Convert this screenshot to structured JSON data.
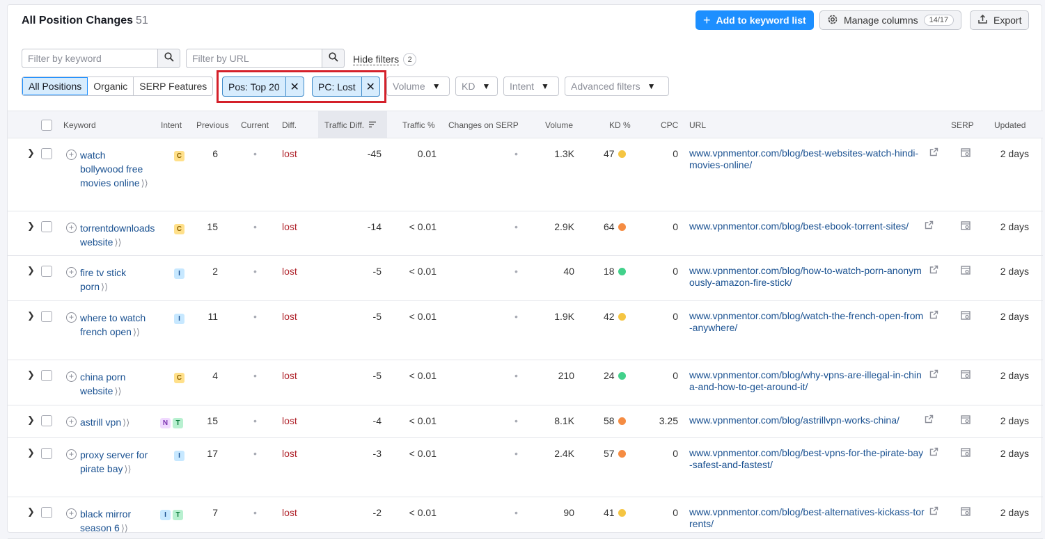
{
  "header": {
    "title": "All Position Changes",
    "count": "51",
    "add_button": "Add to keyword list",
    "manage_columns": "Manage columns",
    "columns_badge": "14/17",
    "export": "Export"
  },
  "filters": {
    "keyword_placeholder": "Filter by keyword",
    "url_placeholder": "Filter by URL",
    "hide_filters": "Hide filters",
    "hide_filters_count": "2",
    "segments": [
      "All Positions",
      "Organic",
      "SERP Features"
    ],
    "chip_pos": "Pos: Top 20",
    "chip_pc": "PC: Lost",
    "volume": "Volume",
    "kd": "KD",
    "intent": "Intent",
    "advanced": "Advanced filters"
  },
  "columns": {
    "keyword": "Keyword",
    "intent": "Intent",
    "previous": "Previous",
    "current": "Current",
    "diff": "Diff.",
    "traffic_diff": "Traffic Diff.",
    "traffic_pct": "Traffic %",
    "changes_serp": "Changes on SERP",
    "volume": "Volume",
    "kd": "KD %",
    "cpc": "CPC",
    "url": "URL",
    "serp": "SERP",
    "updated": "Updated"
  },
  "colors": {
    "kd_yellow": "#f5c542",
    "kd_orange": "#f58c42",
    "kd_green": "#42d18b"
  },
  "rows": [
    {
      "keyword": "watch bollywood free movies online",
      "intents": [
        "C"
      ],
      "previous": "6",
      "current": "•",
      "diff": "lost",
      "traffic_diff": "-45",
      "traffic_pct": "0.01",
      "changes": "•",
      "volume": "1.3K",
      "kd": "47",
      "kd_color": "yellow",
      "cpc": "0",
      "url": "www.vpnmentor.com/blog/best-websites-watch-hindi-movies-online/",
      "updated": "2 days"
    },
    {
      "keyword": "torrentdownloads website",
      "intents": [
        "C"
      ],
      "previous": "15",
      "current": "•",
      "diff": "lost",
      "traffic_diff": "-14",
      "traffic_pct": "< 0.01",
      "changes": "•",
      "volume": "2.9K",
      "kd": "64",
      "kd_color": "orange",
      "cpc": "0",
      "url": "www.vpnmentor.com/blog/best-ebook-torrent-sites/",
      "updated": "2 days"
    },
    {
      "keyword": "fire tv stick porn",
      "intents": [
        "I"
      ],
      "previous": "2",
      "current": "•",
      "diff": "lost",
      "traffic_diff": "-5",
      "traffic_pct": "< 0.01",
      "changes": "•",
      "volume": "40",
      "kd": "18",
      "kd_color": "green",
      "cpc": "0",
      "url": "www.vpnmentor.com/blog/how-to-watch-porn-anonymously-amazon-fire-stick/",
      "updated": "2 days"
    },
    {
      "keyword": "where to watch french open",
      "intents": [
        "I"
      ],
      "previous": "11",
      "current": "•",
      "diff": "lost",
      "traffic_diff": "-5",
      "traffic_pct": "< 0.01",
      "changes": "•",
      "volume": "1.9K",
      "kd": "42",
      "kd_color": "yellow",
      "cpc": "0",
      "url": "www.vpnmentor.com/blog/watch-the-french-open-from-anywhere/",
      "updated": "2 days"
    },
    {
      "keyword": "china porn website",
      "intents": [
        "C"
      ],
      "previous": "4",
      "current": "•",
      "diff": "lost",
      "traffic_diff": "-5",
      "traffic_pct": "< 0.01",
      "changes": "•",
      "volume": "210",
      "kd": "24",
      "kd_color": "green",
      "cpc": "0",
      "url": "www.vpnmentor.com/blog/why-vpns-are-illegal-in-china-and-how-to-get-around-it/",
      "updated": "2 days"
    },
    {
      "keyword": "astrill vpn",
      "intents": [
        "N",
        "T"
      ],
      "previous": "15",
      "current": "•",
      "diff": "lost",
      "traffic_diff": "-4",
      "traffic_pct": "< 0.01",
      "changes": "•",
      "volume": "8.1K",
      "kd": "58",
      "kd_color": "orange",
      "cpc": "3.25",
      "url": "www.vpnmentor.com/blog/astrillvpn-works-china/",
      "updated": "2 days"
    },
    {
      "keyword": "proxy server for pirate bay",
      "intents": [
        "I"
      ],
      "previous": "17",
      "current": "•",
      "diff": "lost",
      "traffic_diff": "-3",
      "traffic_pct": "< 0.01",
      "changes": "•",
      "volume": "2.4K",
      "kd": "57",
      "kd_color": "orange",
      "cpc": "0",
      "url": "www.vpnmentor.com/blog/best-vpns-for-the-pirate-bay-safest-and-fastest/",
      "updated": "2 days"
    },
    {
      "keyword": "black mirror season 6",
      "intents": [
        "I",
        "T"
      ],
      "previous": "7",
      "current": "•",
      "diff": "lost",
      "traffic_diff": "-2",
      "traffic_pct": "< 0.01",
      "changes": "•",
      "volume": "90",
      "kd": "41",
      "kd_color": "yellow",
      "cpc": "0",
      "url": "www.vpnmentor.com/blog/best-alternatives-kickass-torrents/",
      "updated": "2 days"
    }
  ]
}
